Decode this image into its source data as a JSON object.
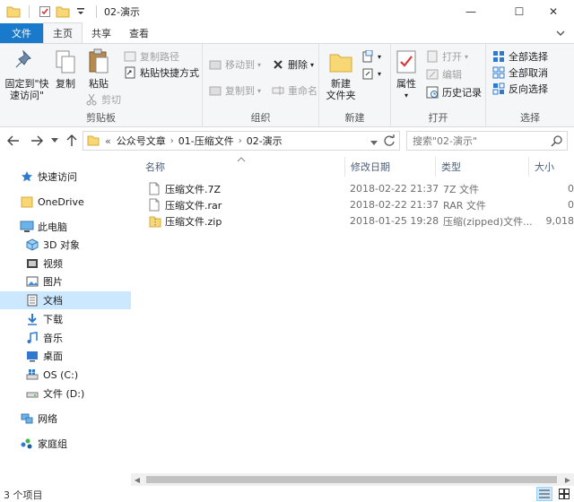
{
  "window": {
    "title": "02-演示",
    "minimize": "—",
    "maximize": "☐",
    "close": "✕"
  },
  "tabs": {
    "file": "文件",
    "home": "主页",
    "share": "共享",
    "view": "查看"
  },
  "ribbon": {
    "clipboard": {
      "label": "剪贴板",
      "pin": "固定到\"快速访问\"",
      "pin_line1": "固定到\"快",
      "pin_line2": "速访问\"",
      "copy": "复制",
      "paste": "粘贴",
      "copy_path": "复制路径",
      "paste_shortcut": "粘贴快捷方式",
      "cut": "剪切"
    },
    "organize": {
      "label": "组织",
      "move_to": "移动到",
      "copy_to": "复制到",
      "delete": "删除",
      "rename": "重命名"
    },
    "new": {
      "label": "新建",
      "new_folder_line1": "新建",
      "new_folder_line2": "文件夹"
    },
    "open": {
      "label": "打开",
      "properties": "属性",
      "open": "打开",
      "edit": "编辑",
      "history": "历史记录"
    },
    "select": {
      "label": "选择",
      "select_all": "全部选择",
      "select_none": "全部取消",
      "invert": "反向选择"
    }
  },
  "address": {
    "overflow": "«",
    "crumbs": [
      "公众号文章",
      "01-压缩文件",
      "02-演示"
    ],
    "search_placeholder": "搜索\"02-演示\""
  },
  "nav": {
    "quick_access": "快速访问",
    "onedrive": "OneDrive",
    "this_pc": "此电脑",
    "objects3d": "3D 对象",
    "videos": "视频",
    "pictures": "图片",
    "documents": "文档",
    "downloads": "下载",
    "music": "音乐",
    "desktop": "桌面",
    "drive_c": "OS (C:)",
    "drive_d": "文件 (D:)",
    "network": "网络",
    "homegroup": "家庭组"
  },
  "columns": {
    "name": "名称",
    "date": "修改日期",
    "type": "类型",
    "size": "大小"
  },
  "files": [
    {
      "name": "压缩文件.7Z",
      "date": "2018-02-22 21:37",
      "type": "7Z 文件",
      "size": "0"
    },
    {
      "name": "压缩文件.rar",
      "date": "2018-02-22 21:37",
      "type": "RAR 文件",
      "size": "0"
    },
    {
      "name": "压缩文件.zip",
      "date": "2018-01-25 19:28",
      "type": "压缩(zipped)文件...",
      "size": "9,018"
    }
  ],
  "status": {
    "count": "3 个项目"
  },
  "colors": {
    "accent": "#1979ca",
    "selected": "#cce8ff",
    "folder": "#f8d775"
  }
}
